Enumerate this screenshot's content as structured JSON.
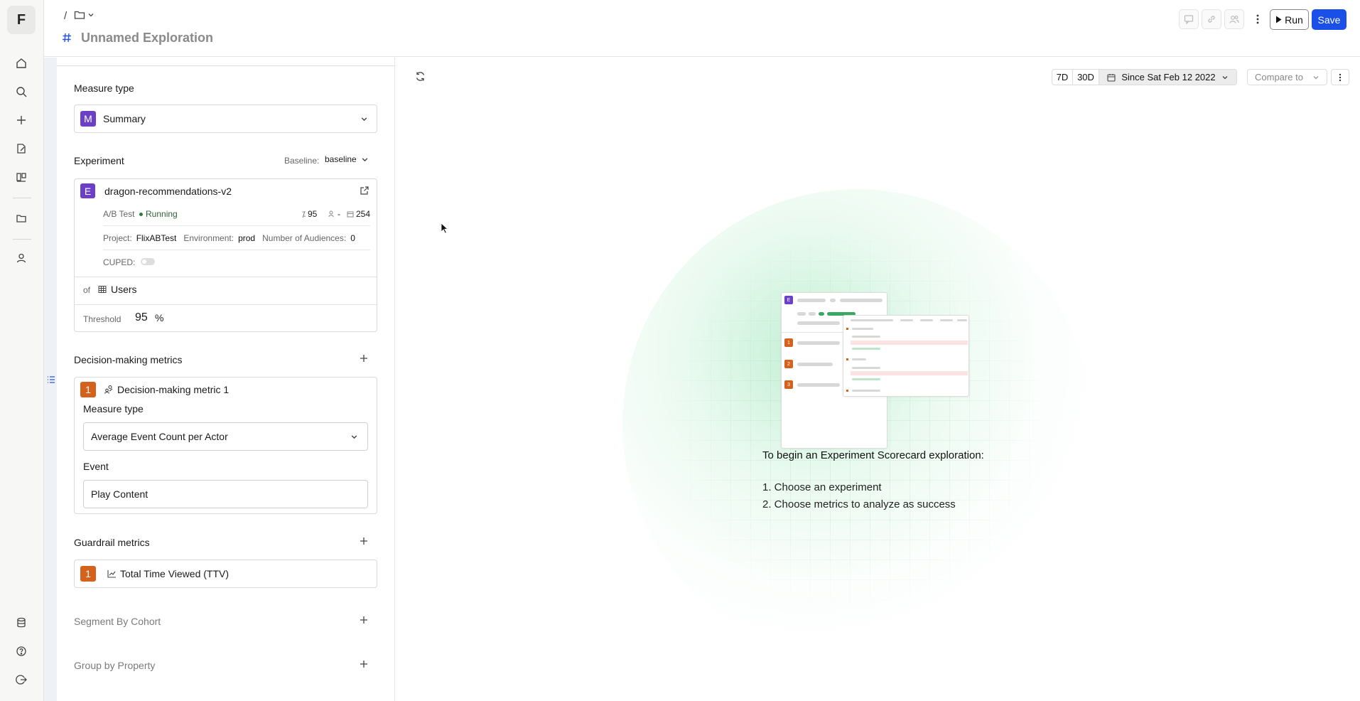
{
  "app": {
    "logo_letter": "F"
  },
  "breadcrumb": {
    "separator": "/"
  },
  "header": {
    "title": "Unnamed Exploration",
    "run_label": "Run",
    "save_label": "Save"
  },
  "panel": {
    "measure_type": {
      "label": "Measure type",
      "badge": "M",
      "value": "Summary"
    },
    "experiment": {
      "label": "Experiment",
      "baseline_label": "Baseline:",
      "baseline_value": "baseline",
      "badge": "E",
      "name": "dragon-recommendations-v2",
      "type": "A/B Test",
      "status": "Running",
      "confidence": "95",
      "audiences_stat": "-",
      "days": "254",
      "project_label": "Project:",
      "project_value": "FlixABTest",
      "environment_label": "Environment:",
      "environment_value": "prod",
      "audiences_label": "Number of Audiences:",
      "audiences_value": "0",
      "cuped_label": "CUPED:",
      "of_label": "of",
      "of_value": "Users",
      "threshold_label": "Threshold",
      "threshold_value": "95",
      "threshold_unit": "%"
    },
    "decision_metrics": {
      "label": "Decision-making metrics",
      "items": [
        {
          "index": "1",
          "name": "Decision-making metric 1",
          "measure_type_label": "Measure type",
          "measure_type_value": "Average Event Count per Actor",
          "event_label": "Event",
          "event_value": "Play Content"
        }
      ]
    },
    "guardrail_metrics": {
      "label": "Guardrail metrics",
      "items": [
        {
          "index": "1",
          "name": "Total Time Viewed (TTV)"
        }
      ]
    },
    "segment_by_cohort": {
      "label": "Segment By Cohort"
    },
    "group_by_property": {
      "label": "Group by Property"
    }
  },
  "toolbar": {
    "range_7d": "7D",
    "range_30d": "30D",
    "since_label": "Since Sat Feb 12 2022",
    "compare_label": "Compare to"
  },
  "empty_state": {
    "heading": "To begin an Experiment Scorecard exploration:",
    "steps": [
      "1. Choose an experiment",
      "2. Choose metrics to analyze as success"
    ],
    "illustration": {
      "badge_e": "E",
      "badge_1": "1",
      "badge_2": "2",
      "badge_3": "3"
    }
  },
  "colors": {
    "accent": "#1a4fe8",
    "badge_purple": "#6b3fc6",
    "badge_orange": "#d4621c",
    "running_green": "#2f7d3c"
  }
}
